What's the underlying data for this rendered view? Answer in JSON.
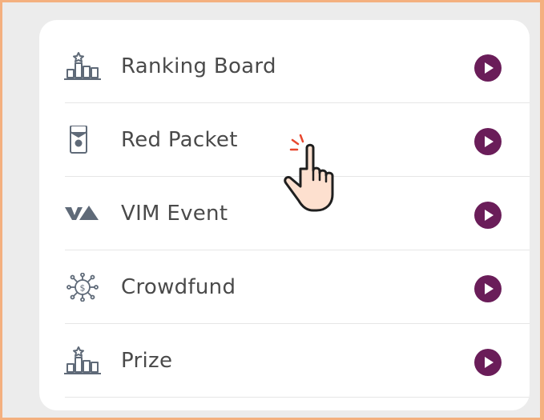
{
  "menu": {
    "items": [
      {
        "label": "Ranking Board",
        "icon": "ranking-board-icon"
      },
      {
        "label": "Red Packet",
        "icon": "red-packet-icon"
      },
      {
        "label": "VIM Event",
        "icon": "vim-event-icon"
      },
      {
        "label": "Crowdfund",
        "icon": "crowdfund-icon"
      },
      {
        "label": "Prize",
        "icon": "prize-icon"
      }
    ]
  },
  "colors": {
    "accent": "#6a1d59",
    "icon": "#5f6a78",
    "text": "#4a4a4a",
    "click_mark": "#e8472e"
  }
}
